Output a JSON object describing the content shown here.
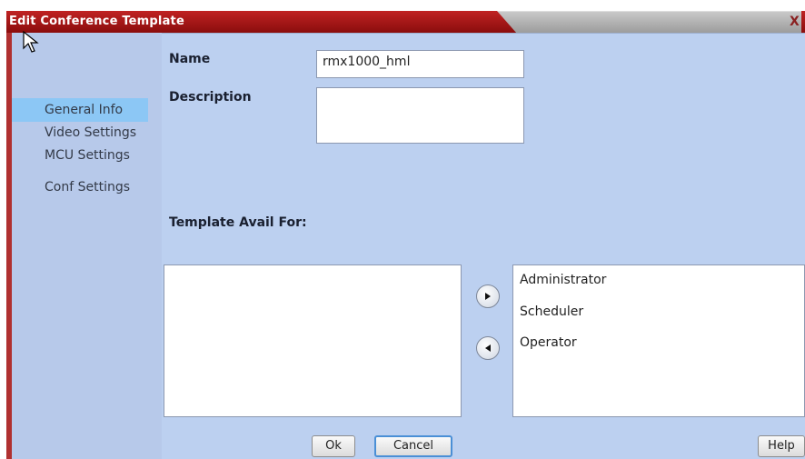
{
  "window": {
    "title": "Edit Conference Template",
    "close_glyph": "X"
  },
  "sidebar": {
    "items": [
      {
        "label": "General Info",
        "active": true
      },
      {
        "label": "Video Settings",
        "active": false
      },
      {
        "label": "MCU Settings",
        "active": false
      },
      {
        "label": "Conf Settings",
        "active": false
      }
    ]
  },
  "form": {
    "name_label": "Name",
    "name_value": "rmx1000_hml",
    "description_label": "Description",
    "description_value": "",
    "avail_label": "Template Avail For:",
    "left_list": [],
    "right_list": [
      "Administrator",
      "Scheduler",
      "Operator"
    ]
  },
  "buttons": {
    "ok": "Ok",
    "cancel": "Cancel",
    "help": "Help"
  },
  "colors": {
    "titlebar": "#b01818",
    "sidebar": "#b7c9ea",
    "content": "#bcd0f0",
    "active_item": "#8cc7f5"
  },
  "icons": {
    "move_right": "arrow-right-icon",
    "move_left": "arrow-left-icon"
  }
}
